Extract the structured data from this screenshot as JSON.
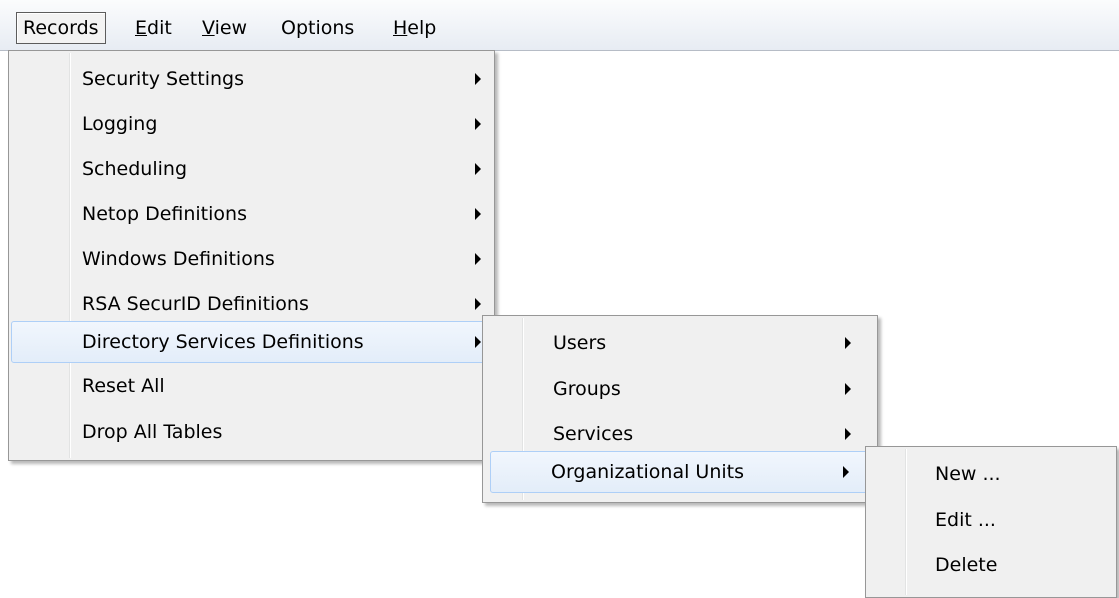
{
  "menubar": [
    {
      "label": "Records",
      "mnemonic": ""
    },
    {
      "label": "Edit",
      "mnemonic": "E"
    },
    {
      "label": "View",
      "mnemonic": "V"
    },
    {
      "label": "Options",
      "mnemonic": ""
    },
    {
      "label": "Help",
      "mnemonic": "H"
    }
  ],
  "records_menu": [
    {
      "label": "Security Settings",
      "submenu": true
    },
    {
      "label": "Logging",
      "submenu": true
    },
    {
      "label": "Scheduling",
      "submenu": true
    },
    {
      "label": "Netop Definitions",
      "submenu": true
    },
    {
      "label": "Windows Definitions",
      "submenu": true
    },
    {
      "label": "RSA SecurID Definitions",
      "submenu": true
    },
    {
      "label": "Directory Services Definitions",
      "submenu": true,
      "highlighted": true
    },
    {
      "label": "Reset All",
      "submenu": false
    },
    {
      "label": "Drop All Tables",
      "submenu": false
    }
  ],
  "directory_menu": [
    {
      "label": "Users",
      "submenu": true
    },
    {
      "label": "Groups",
      "submenu": true
    },
    {
      "label": "Services",
      "submenu": true
    },
    {
      "label": "Organizational Units",
      "submenu": true,
      "highlighted": true
    }
  ],
  "ou_menu": [
    {
      "label": "New ...",
      "submenu": false
    },
    {
      "label": "Edit ...",
      "submenu": false
    },
    {
      "label": "Delete",
      "submenu": false
    }
  ],
  "colors": {
    "highlight_bg": "#e3edf9",
    "highlight_border": "#aecff7",
    "menu_bg": "#f0f0f0"
  }
}
